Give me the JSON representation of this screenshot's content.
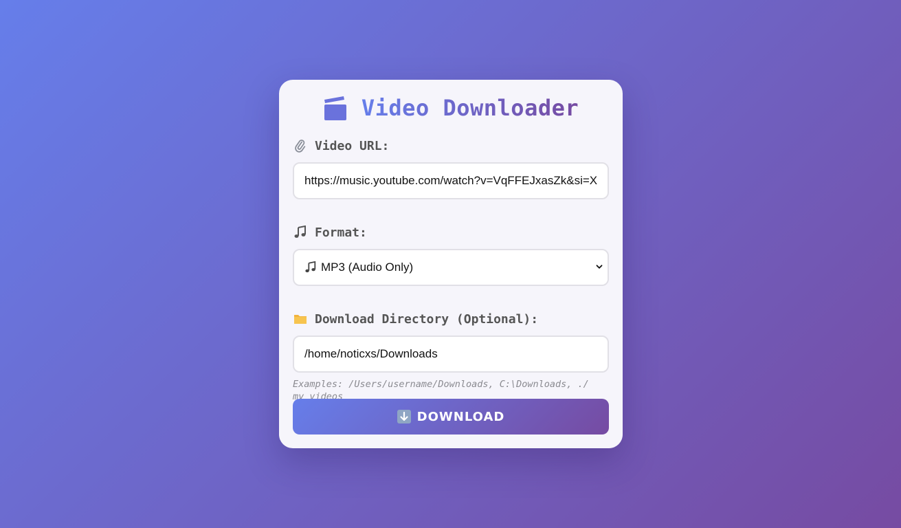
{
  "app": {
    "title": "Video Downloader",
    "accent_start": "#667eea",
    "accent_end": "#764ba2"
  },
  "form": {
    "url": {
      "icon": "paperclip-icon",
      "label": "Video URL:",
      "value": "https://music.youtube.com/watch?v=VqFFEJxasZk&si=X"
    },
    "format": {
      "icon": "music-note-icon",
      "label": "Format:",
      "selected": "MP3 (Audio Only)"
    },
    "directory": {
      "icon": "folder-icon",
      "label": "Download Directory (Optional):",
      "value": "/home/noticxs/Downloads",
      "hint": "Examples: /Users/username/Downloads, C:\\Downloads, ./ my_videos"
    },
    "download_label": "DOWNLOAD"
  }
}
